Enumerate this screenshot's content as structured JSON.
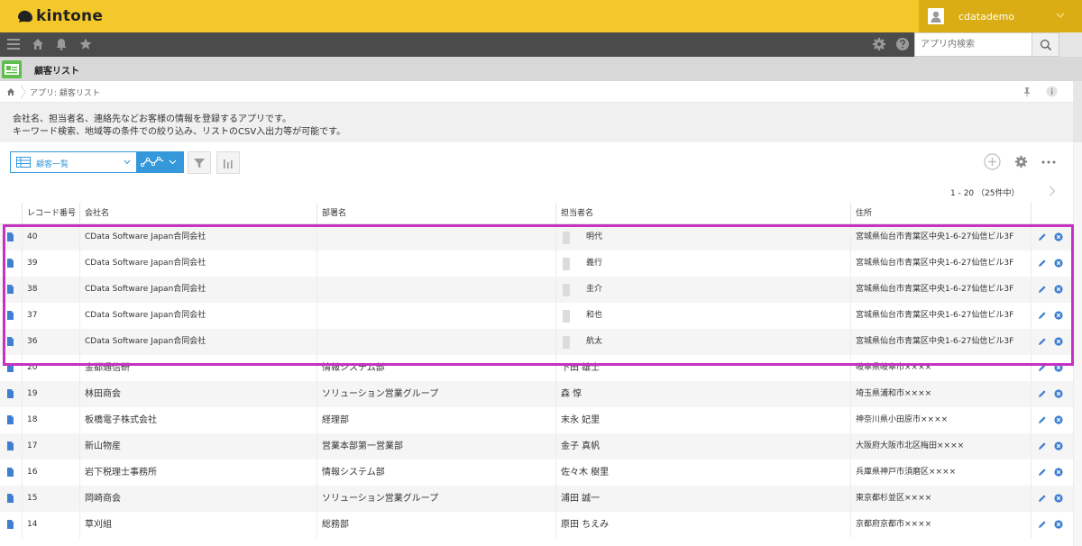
{
  "header": {
    "logo_text": "kintone",
    "user_name": "cdatademo"
  },
  "nav": {
    "search_placeholder": "アプリ内検索"
  },
  "app": {
    "title": "顧客リスト"
  },
  "breadcrumb": {
    "text": "アプリ: 顧客リスト"
  },
  "description": {
    "line1": "会社名、担当者名、連絡先などお客様の情報を登録するアプリです。",
    "line2": "キーワード検索、地域等の条件での絞り込み、リストのCSV入出力等が可能です。"
  },
  "toolbar": {
    "view_label": "顧客一覧"
  },
  "pager": {
    "text": "1 - 20 （25件中）"
  },
  "table": {
    "headers": [
      "レコード番号",
      "会社名",
      "部署名",
      "担当者名",
      "住所"
    ],
    "rows": [
      {
        "id": "40",
        "company": "CData Software Japan合同会社",
        "dept": "",
        "person": "明代",
        "address": "宮城県仙台市青葉区中央1-6-27仙信ビル3F"
      },
      {
        "id": "39",
        "company": "CData Software Japan合同会社",
        "dept": "",
        "person": "義行",
        "address": "宮城県仙台市青葉区中央1-6-27仙信ビル3F"
      },
      {
        "id": "38",
        "company": "CData Software Japan合同会社",
        "dept": "",
        "person": "圭介",
        "address": "宮城県仙台市青葉区中央1-6-27仙信ビル3F"
      },
      {
        "id": "37",
        "company": "CData Software Japan合同会社",
        "dept": "",
        "person": "和也",
        "address": "宮城県仙台市青葉区中央1-6-27仙信ビル3F"
      },
      {
        "id": "36",
        "company": "CData Software Japan合同会社",
        "dept": "",
        "person": "航太",
        "address": "宮城県仙台市青葉区中央1-6-27仙信ビル3F"
      },
      {
        "id": "20",
        "company": "金都通信研",
        "dept": "情報システム部",
        "person": "下田 雄士",
        "address": "岐阜県岐阜市××××"
      },
      {
        "id": "19",
        "company": "林田商会",
        "dept": "ソリューション営業グループ",
        "person": "森 惇",
        "address": "埼玉県浦和市××××"
      },
      {
        "id": "18",
        "company": "板橋電子株式会社",
        "dept": "経理部",
        "person": "末永 妃里",
        "address": "神奈川県小田原市××××"
      },
      {
        "id": "17",
        "company": "新山物産",
        "dept": "営業本部第一営業部",
        "person": "金子 真帆",
        "address": "大阪府大阪市北区梅田××××"
      },
      {
        "id": "16",
        "company": "岩下税理士事務所",
        "dept": "情報システム部",
        "person": "佐々木 樹里",
        "address": "兵庫県神戸市須磨区××××"
      },
      {
        "id": "15",
        "company": "岡崎商会",
        "dept": "ソリューション営業グループ",
        "person": "浦田 誠一",
        "address": "東京都杉並区××××"
      },
      {
        "id": "14",
        "company": "草刈組",
        "dept": "総務部",
        "person": "原田 ちえみ",
        "address": "京都府京都市××××"
      }
    ]
  },
  "colors": {
    "header_yellow": "#f4c82b",
    "navbar": "#4b4b4b",
    "accent_blue": "#3498db",
    "highlight_magenta": "#c632c2"
  }
}
